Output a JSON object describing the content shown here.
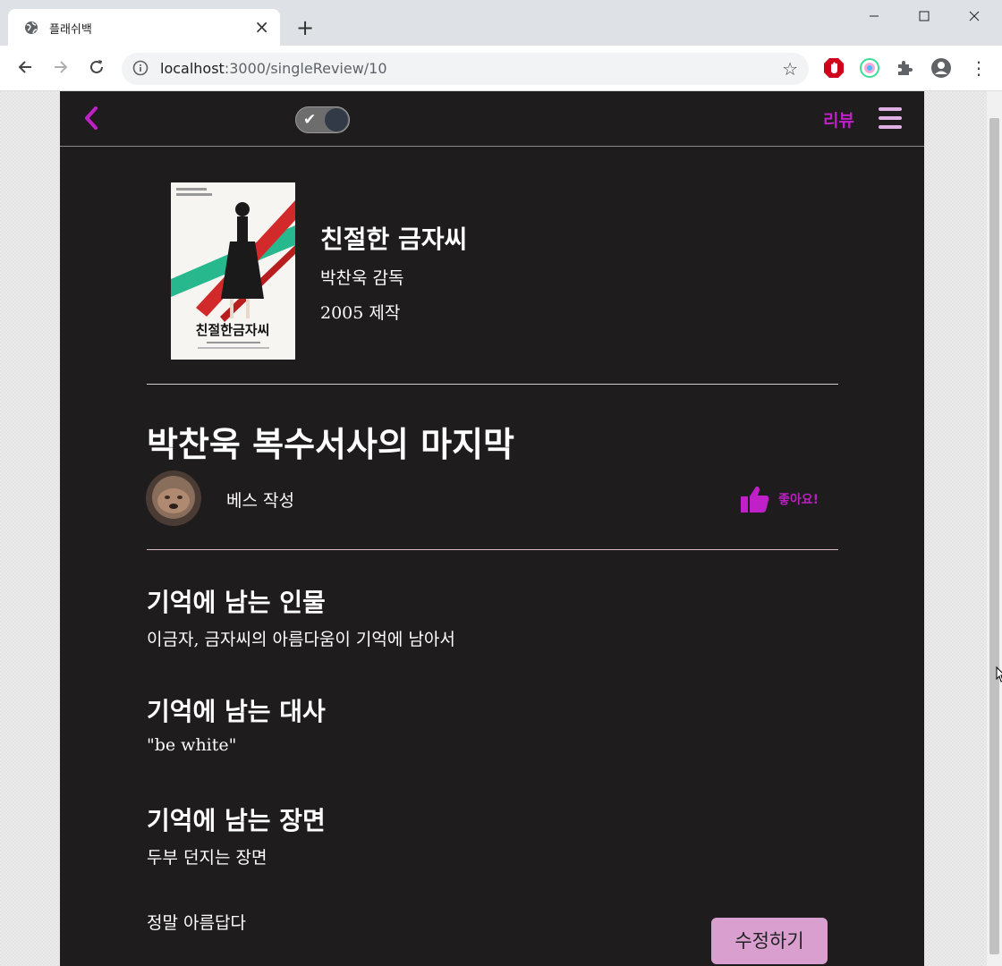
{
  "browser": {
    "tab_title": "플래쉬백",
    "new_tab_symbol": "+",
    "url_host": "localhost",
    "url_rest": ":3000/singleReview/10"
  },
  "header": {
    "review_link": "리뷰"
  },
  "movie": {
    "title": "친절한 금자씨",
    "director": "박찬욱 감독",
    "year": "2005 제작",
    "poster_title": "친절한금자씨"
  },
  "review": {
    "title": "박찬욱 복수서사의 마지막",
    "author": "베스 작성",
    "like_label": "좋아요!",
    "sections": [
      {
        "heading": "기억에 남는 인물",
        "body": "이금자, 금자씨의 아름다움이 기억에 남아서"
      },
      {
        "heading": "기억에 남는 대사",
        "body": "\"be white\""
      },
      {
        "heading": "기억에 남는 장면",
        "body": "두부 던지는 장면"
      }
    ],
    "comment": "정말 아름답다",
    "edit_button": "수정하기"
  },
  "colors": {
    "accent": "#c020c8",
    "page_background": "#1e1c1c",
    "edit_button": "#d9a0cf"
  }
}
